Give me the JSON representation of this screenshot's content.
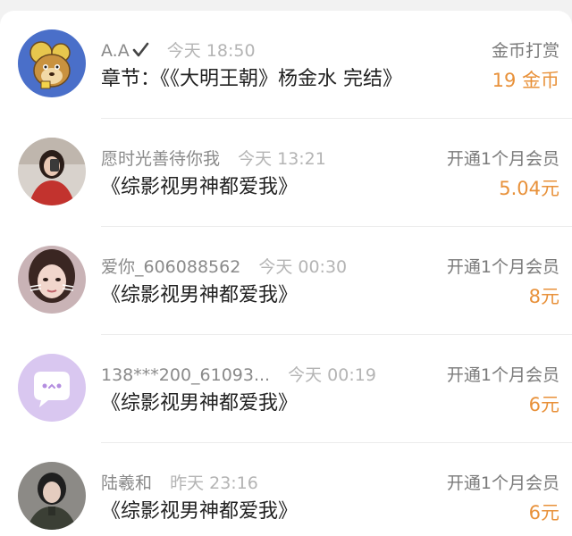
{
  "colors": {
    "accent": "#e8913a",
    "username": "#8a8a8a",
    "timestamp": "#b4b4b4",
    "content": "#222222",
    "divider": "#ececec"
  },
  "rows": [
    {
      "avatar": "cartoon-mouse-avatar",
      "user": "A.A",
      "verified_icon": "check-icon",
      "time": "今天 18:50",
      "content": "章节：《《大明王朝》杨金水 完结》",
      "action": "金币打赏",
      "amount": "19 金币"
    },
    {
      "avatar": "photo-avatar",
      "user": "愿时光善待你我",
      "time": "今天 13:21",
      "content": "《综影视男神都爱我》",
      "action": "开通1个月会员",
      "amount": "5.04元"
    },
    {
      "avatar": "photo-avatar",
      "user": "爱你_606088562",
      "time": "今天 00:30",
      "content": "《综影视男神都爱我》",
      "action": "开通1个月会员",
      "amount": "8元"
    },
    {
      "avatar": "chat-bubble-avatar",
      "user": "138***200_61093...",
      "time": "今天 00:19",
      "content": "《综影视男神都爱我》",
      "action": "开通1个月会员",
      "amount": "6元"
    },
    {
      "avatar": "photo-avatar",
      "user": "陆羲和",
      "time": "昨天 23:16",
      "content": "《综影视男神都爱我》",
      "action": "开通1个月会员",
      "amount": "6元"
    }
  ]
}
